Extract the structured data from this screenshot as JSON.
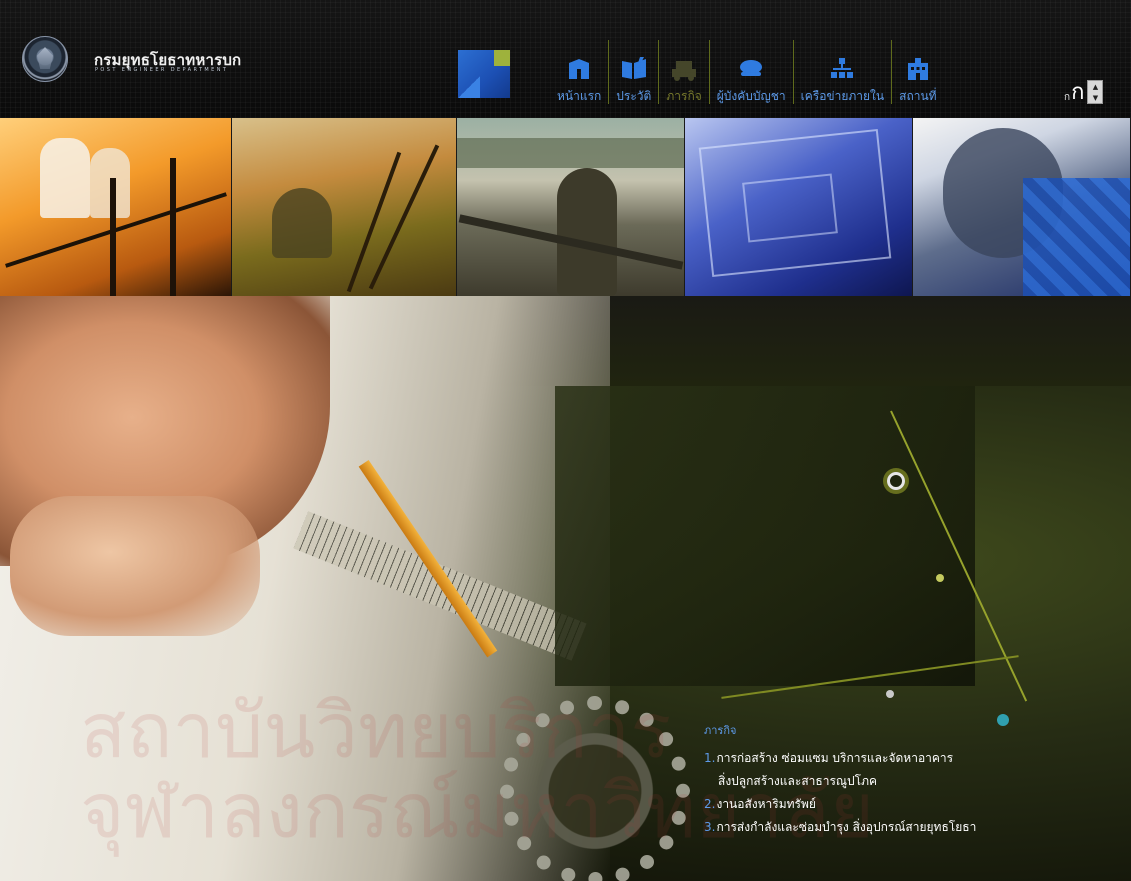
{
  "header": {
    "logo_title": "กรมยุทธโยธาทหารบก",
    "logo_subtitle": "POST ENGINEER DEPARTMENT"
  },
  "nav": {
    "items": [
      {
        "label": "หน้าแรก",
        "icon": "home-icon"
      },
      {
        "label": "ประวัติ",
        "icon": "book-icon"
      },
      {
        "label": "ภารกิจ",
        "icon": "truck-icon"
      },
      {
        "label": "ผู้บังคับบัญชา",
        "icon": "officer-cap-icon"
      },
      {
        "label": "เครือข่ายภายใน",
        "icon": "network-icon"
      },
      {
        "label": "สถานที่",
        "icon": "building-icon"
      }
    ],
    "active_index": 2
  },
  "font_control": {
    "small_glyph": "ก",
    "large_glyph": "ก",
    "up": "▲",
    "down": "▼"
  },
  "mission": {
    "heading": "ภารกิจ",
    "items": [
      {
        "num": "1.",
        "text": "การก่อสร้าง ซ่อมแซม บริการและจัดหาอาคาร",
        "continuation": "สิ่งปลูกสร้างและสาธารณูปโภค"
      },
      {
        "num": "2.",
        "text": "งานอสังหาริมทรัพย์"
      },
      {
        "num": "3.",
        "text": "การส่งกำลังและซ่อมบำรุง สิ่งอุปกรณ์สายยุทธโยธา"
      }
    ]
  },
  "watermark": {
    "line1": "สถาบันวิทยบริการ",
    "line2": "จุฬาลงกรณ์มหาวิทยาลัย"
  },
  "colors": {
    "nav_label": "#5d9ae8",
    "nav_active": "#77792c",
    "nav_divider": "#5f6b1c",
    "brand_blue": "#2c6fd2",
    "brand_green": "#9eb23c"
  }
}
